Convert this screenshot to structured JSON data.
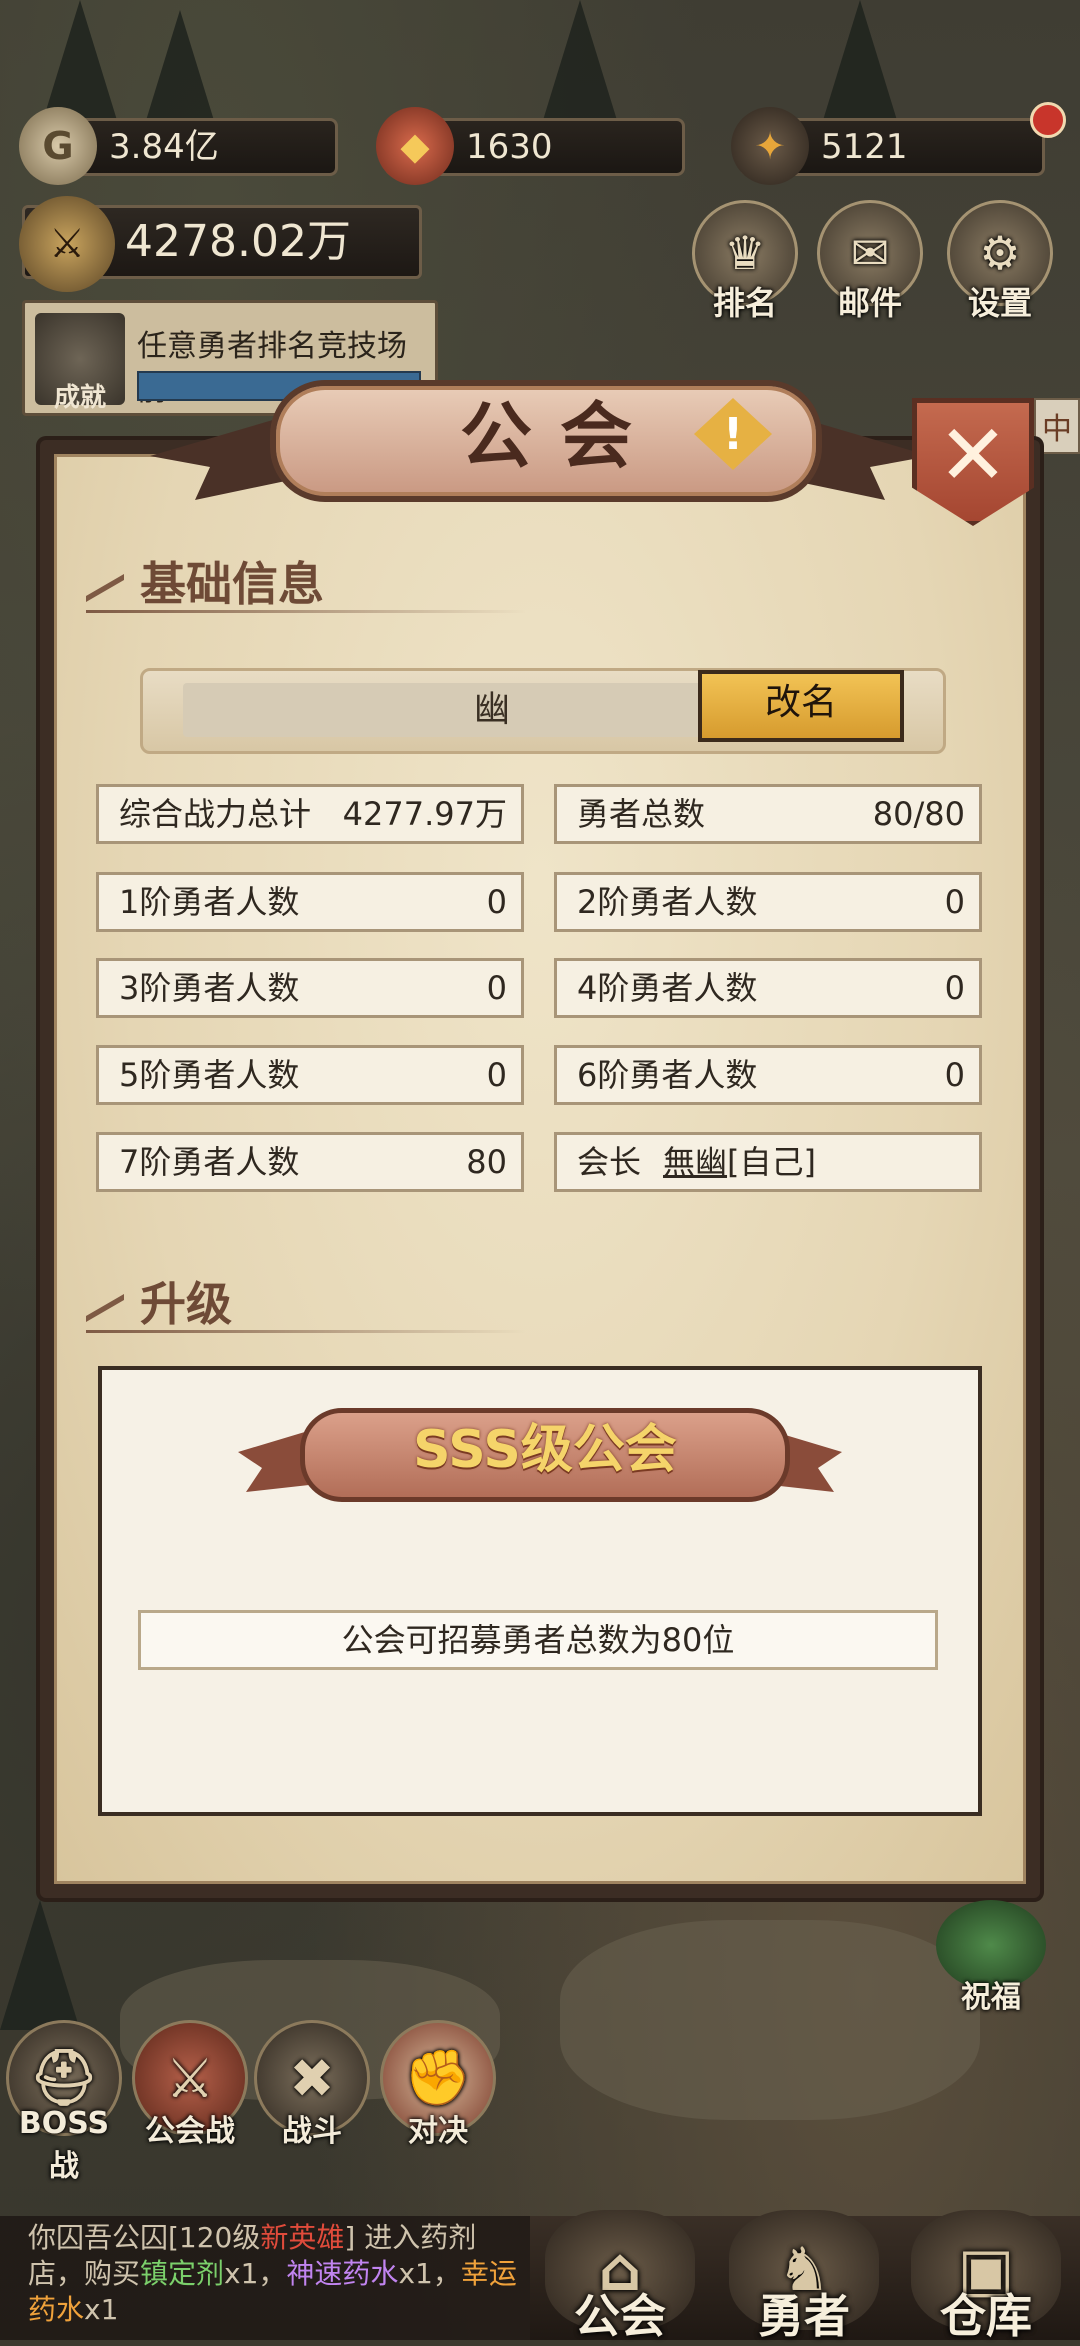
{
  "resources": {
    "gold": "3.84亿",
    "gems": "1630",
    "crystals": "5121",
    "power": "4278.02万"
  },
  "top_buttons": {
    "rank": "排名",
    "mail": "邮件",
    "settings": "设置"
  },
  "quest": {
    "text": "任意勇者排名竞技场前",
    "icon_label": "成就"
  },
  "side_tags": {
    "middle": "中"
  },
  "panel": {
    "title": "公会",
    "section_basic": "基础信息",
    "guild_name": "幽",
    "rename_label": "改名",
    "stats": [
      {
        "label": "综合战力总计",
        "value": "4277.97万"
      },
      {
        "label": "勇者总数",
        "value": "80/80"
      },
      {
        "label": "1阶勇者人数",
        "value": "0"
      },
      {
        "label": "2阶勇者人数",
        "value": "0"
      },
      {
        "label": "3阶勇者人数",
        "value": "0"
      },
      {
        "label": "4阶勇者人数",
        "value": "0"
      },
      {
        "label": "5阶勇者人数",
        "value": "0"
      },
      {
        "label": "6阶勇者人数",
        "value": "0"
      },
      {
        "label": "7阶勇者人数",
        "value": "80"
      }
    ],
    "leader": {
      "label": "会长",
      "name": "無幽",
      "suffix": "[自己]"
    },
    "section_upgrade": "升级",
    "grade": "SSS级公会",
    "recruit_text": "公会可招募勇者总数为80位"
  },
  "bottom_buttons": {
    "boss": "BOSS战",
    "guild_war": "公会战",
    "battle": "战斗",
    "duel": "对决",
    "blessing": "祝福"
  },
  "log": {
    "line1": "你囚吾公囚[120级",
    "line1_red": "新英雄",
    "line1_end": "] 进入药剂",
    "line2a": "店，购买",
    "item1": "镇定剂",
    "q1": "x1，",
    "item2": "神速药水",
    "q2": "x1，",
    "item3a": "幸运",
    "item3b": "药水",
    "q3": "x1"
  },
  "nav": {
    "guild": "公会",
    "heroes": "勇者",
    "warehouse": "仓库"
  },
  "colors": {
    "accent_gold": "#f2c355",
    "panel_parchment": "#efe4c8",
    "title_brown": "#4a2a1e"
  }
}
